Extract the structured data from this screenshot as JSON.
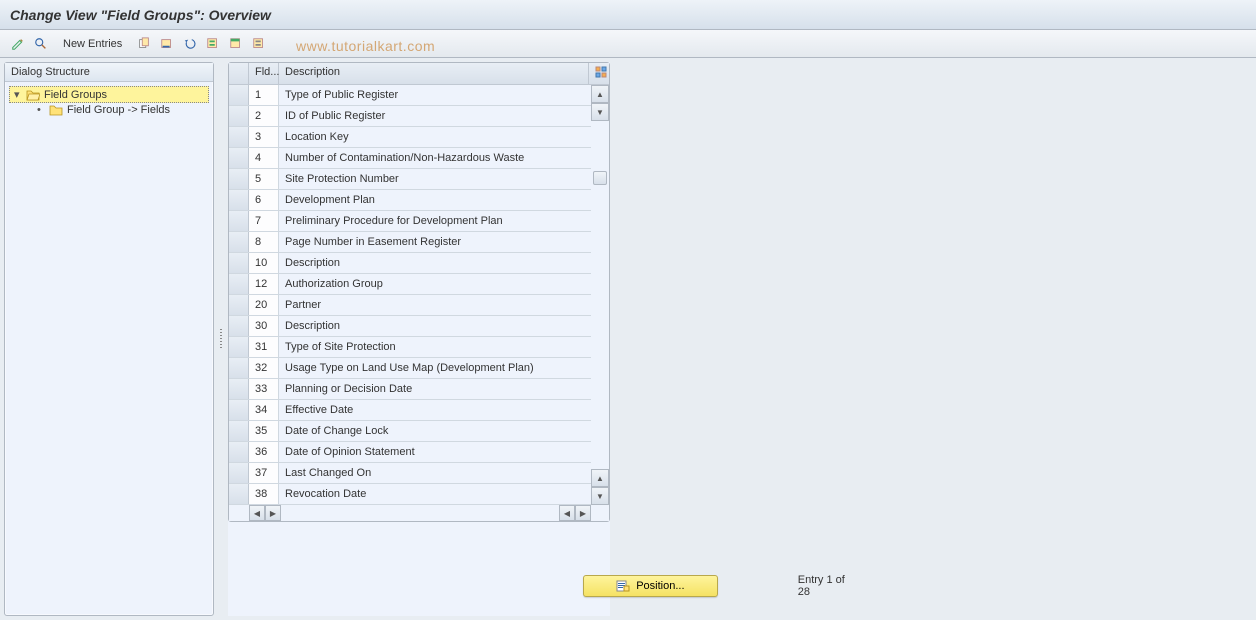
{
  "title": "Change View \"Field Groups\": Overview",
  "toolbar": {
    "new_entries": "New Entries"
  },
  "watermark": "www.tutorialkart.com",
  "dialog": {
    "header": "Dialog Structure",
    "items": [
      {
        "label": "Field Groups",
        "selected": true
      },
      {
        "label": "Field Group -> Fields",
        "selected": false
      }
    ]
  },
  "table": {
    "col_fld": "Fld...",
    "col_desc": "Description",
    "rows": [
      {
        "fld": "1",
        "desc": "Type of Public Register"
      },
      {
        "fld": "2",
        "desc": "ID of Public Register"
      },
      {
        "fld": "3",
        "desc": "Location Key"
      },
      {
        "fld": "4",
        "desc": "Number of Contamination/Non-Hazardous Waste"
      },
      {
        "fld": "5",
        "desc": "Site Protection Number"
      },
      {
        "fld": "6",
        "desc": "Development Plan"
      },
      {
        "fld": "7",
        "desc": "Preliminary Procedure for Development Plan"
      },
      {
        "fld": "8",
        "desc": "Page Number in Easement Register"
      },
      {
        "fld": "10",
        "desc": "Description"
      },
      {
        "fld": "12",
        "desc": "Authorization Group"
      },
      {
        "fld": "20",
        "desc": "Partner"
      },
      {
        "fld": "30",
        "desc": "Description"
      },
      {
        "fld": "31",
        "desc": "Type of Site Protection"
      },
      {
        "fld": "32",
        "desc": "Usage Type on Land Use Map (Development Plan)"
      },
      {
        "fld": "33",
        "desc": "Planning or Decision Date"
      },
      {
        "fld": "34",
        "desc": "Effective Date"
      },
      {
        "fld": "35",
        "desc": "Date of Change Lock"
      },
      {
        "fld": "36",
        "desc": "Date of Opinion Statement"
      },
      {
        "fld": "37",
        "desc": "Last Changed On"
      },
      {
        "fld": "38",
        "desc": "Revocation Date"
      }
    ]
  },
  "footer": {
    "position_label": "Position...",
    "entry_text": "Entry 1 of 28"
  }
}
